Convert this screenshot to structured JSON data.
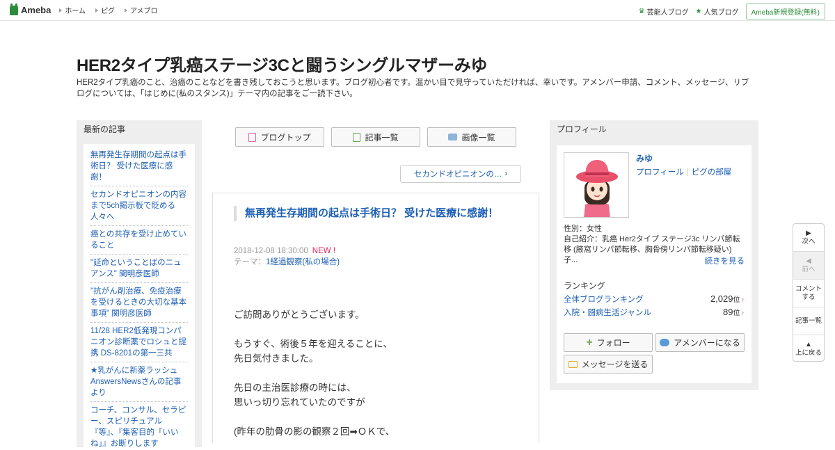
{
  "header": {
    "logo": "Ameba",
    "nav": [
      "ホーム",
      "ピグ",
      "アメブロ"
    ],
    "right_links": [
      "芸能人ブログ",
      "人気ブログ"
    ],
    "signup": "Ameba新規登録(無料)"
  },
  "blog": {
    "title": "HER2タイプ乳癌ステージ3Cと闘うシングルマザーみゆ",
    "description": "HER2タイプ乳癌のこと、治癌のことなどを書き残しておこうと思います。ブログ初心者です。温かい目で見守っていただければ、幸いです。アメンバー申請、コメント、メッセージ、リブログについては、「はじめに(私のスタンス)」テーマ内の記事をご一読下さい。"
  },
  "left_sidebar": {
    "heading": "最新の記事",
    "items": [
      "無再発生存期間の起点は手術日？ 受けた医療に感謝！",
      "セカンドオピニオンの内容まで5ch掲示板で貶める人々へ",
      "癌との共存を受け止めていること",
      "\"延命ということばのニュアンス\" 関明彦医師",
      "\"抗がん剤治療、免疫治療を受けるときの大切な基本事項\" 関明彦医師",
      "11/28 HER2低発現コンパニオン診断薬でロシュと提携 DS-8201の第一三共",
      "★乳がんに新薬ラッシュ AnswersNewsさんの記事より",
      "コーチ、コンサル、セラピー、スピリチュアル『等』、『集客目的「いいね」』お断りします"
    ]
  },
  "center": {
    "buttons": [
      "ブログトップ",
      "記事一覧",
      "画像一覧"
    ],
    "prev_article": "セカンドオピニオンの…",
    "article": {
      "title": "無再発生存期間の起点は手術日？ 受けた医療に感謝！",
      "date": "2018-12-08 18:30:00",
      "new_badge": "NEW !",
      "theme_label": "テーマ：",
      "theme": "1経過観察(私の場合)",
      "body": [
        "ご訪問ありがとうございます。",
        "",
        "もうすぐ、術後５年を迎えることに、",
        "先日気付きました。",
        "",
        "先日の主治医診療の時には、",
        "思いっ切り忘れていたのですが",
        "",
        "(昨年の肋骨の影の観察２回➡ＯＫで、"
      ]
    }
  },
  "right_sidebar": {
    "heading": "プロフィール",
    "name": "みゆ",
    "profile_link": "プロフィール",
    "pig_link": "ピグの部屋",
    "gender": "性別：女性",
    "intro": "自己紹介：乳癌 Her2タイプ ステージ3c リンパ節転移 (腋窩リンパ節転移、胸骨傍リンパ節転移疑い) 子...",
    "more": "続きを見る",
    "ranking_heading": "ランキング",
    "rankings": [
      {
        "label": "全体ブログランキング",
        "value": "2,029",
        "unit": "位",
        "arrow": "↑"
      },
      {
        "label": "入院・闘病生活ジャンル",
        "value": "89",
        "unit": "位",
        "arrow": "↑"
      }
    ],
    "follow": "フォロー",
    "amember": "アメンバーになる",
    "message": "メッセージを送る"
  },
  "float_nav": {
    "next": "次へ",
    "prev": "前へ",
    "comment": "コメントする",
    "list": "記事一覧",
    "top": "上に戻る"
  },
  "colors": {
    "brand_green": "#2d8c3c",
    "link_blue": "#1e5fb4",
    "new_red": "#e0245e"
  }
}
